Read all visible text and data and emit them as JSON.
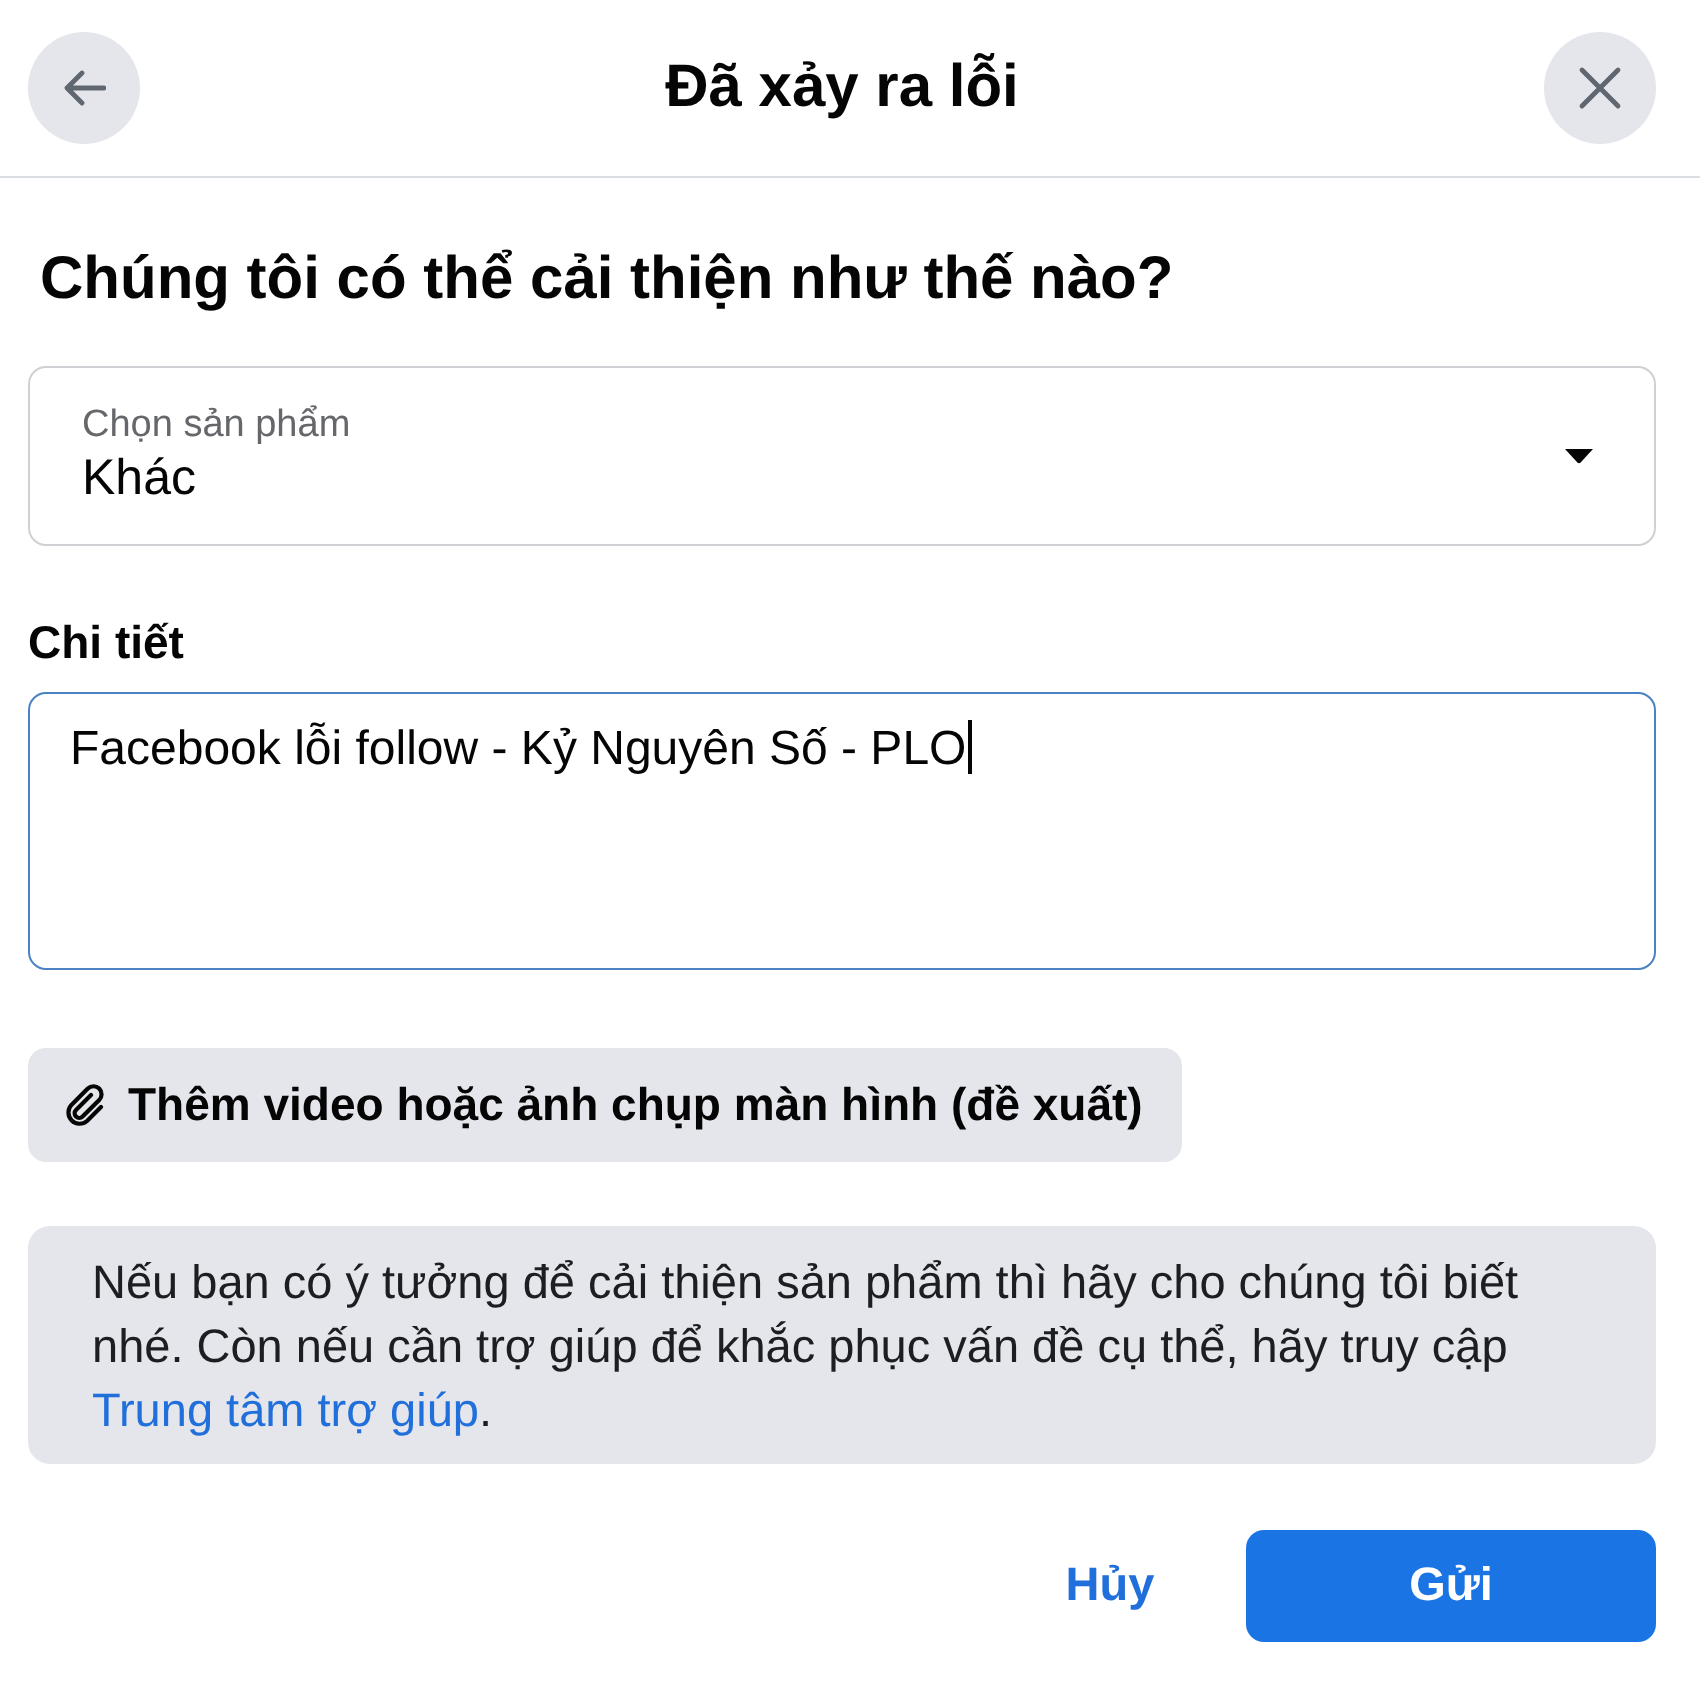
{
  "header": {
    "title": "Đã xảy ra lỗi"
  },
  "heading": "Chúng tôi có thể cải thiện như thế nào?",
  "product_select": {
    "label": "Chọn sản phẩm",
    "value": "Khác"
  },
  "details": {
    "label": "Chi tiết",
    "value": "Facebook lỗi follow - Kỷ Nguyên Số - PLO",
    "focused": true
  },
  "attach_button": {
    "label": "Thêm video hoặc ảnh chụp màn hình (đề xuất)"
  },
  "info": {
    "text": "Nếu bạn có ý tưởng để cải thiện sản phẩm thì hãy cho chúng tôi biết nhé. Còn nếu cần trợ giúp để khắc phục vấn đề cụ thể, hãy truy cập",
    "link": "Trung tâm trợ giúp",
    "after_link": "."
  },
  "buttons": [
    {
      "label": "Hủy",
      "kind": "link"
    },
    {
      "label": "Gửi",
      "kind": "primary"
    }
  ]
}
